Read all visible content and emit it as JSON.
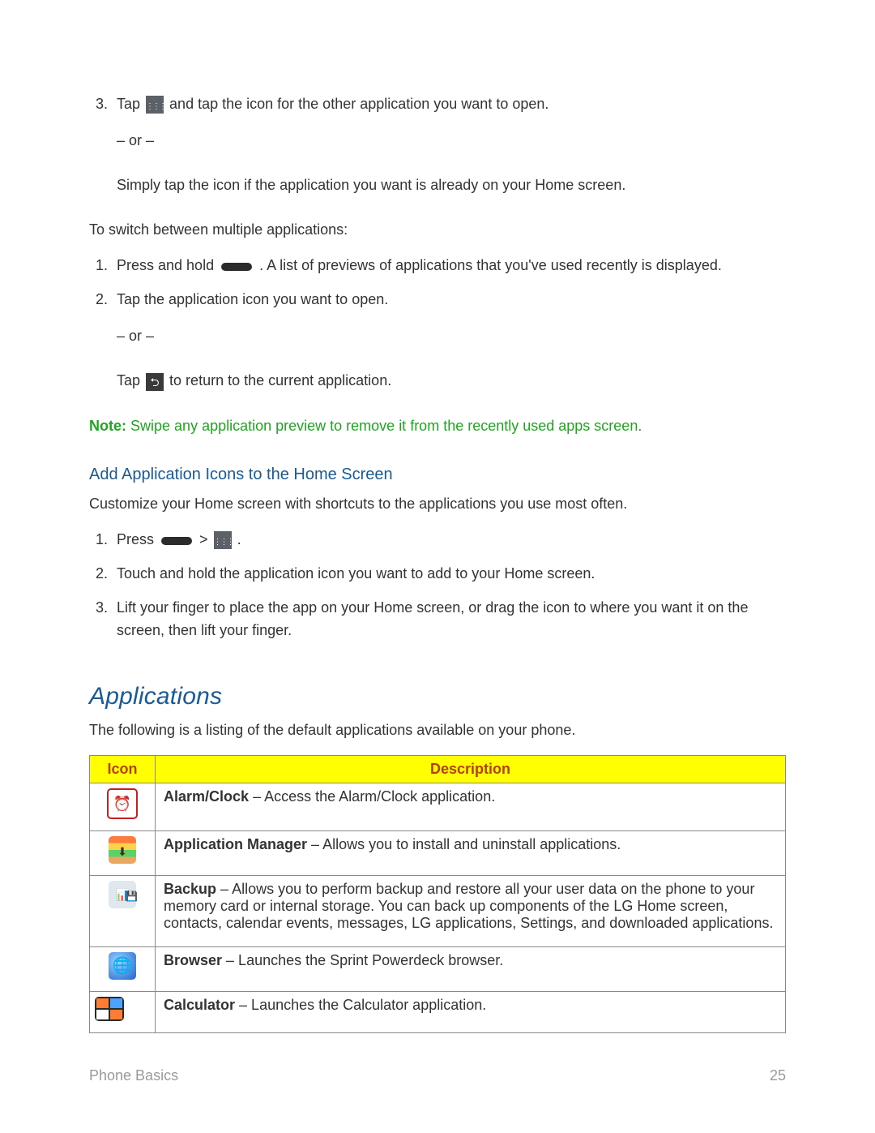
{
  "step3": {
    "before": "Tap ",
    "after": " and tap the icon for the other application you want to open."
  },
  "or_text": "– or –",
  "step3_alt": "Simply tap the icon if the application you want is already on your Home screen.",
  "switch_intro": "To switch between multiple applications:",
  "switch_list": {
    "item1_before": "Press and hold ",
    "item1_after": ". A list of previews of applications that you've used recently is displayed.",
    "item2": "Tap the application icon you want to open."
  },
  "switch_alt_before": "Tap ",
  "switch_alt_after": " to return to the current application.",
  "note": {
    "label": "Note:",
    "text": " Swipe any application preview to remove it from the recently used apps screen."
  },
  "add_icons": {
    "heading": "Add Application Icons to the Home Screen",
    "intro": "Customize your Home screen with shortcuts to the applications you use most often.",
    "steps": {
      "s1_before": "Press ",
      "s1_mid": " > ",
      "s1_after": ".",
      "s2": "Touch and hold the application icon you want to add to your Home screen.",
      "s3": "Lift your finger to place the app on your Home screen, or drag the icon to where you want it on the screen, then lift your finger."
    }
  },
  "applications": {
    "heading": "Applications",
    "intro": "The following is a listing of the default applications available on your phone.",
    "table": {
      "header_icon": "Icon",
      "header_desc": "Description",
      "rows": [
        {
          "name": "Alarm/Clock",
          "desc": " – Access the Alarm/Clock application."
        },
        {
          "name": "Application Manager",
          "desc": " – Allows you to install and uninstall applications."
        },
        {
          "name": "Backup",
          "desc": " – Allows you to perform backup and restore all your user data on the phone to your memory card or internal storage. You can back up components of the LG Home screen, contacts, calendar events, messages, LG applications, Settings, and downloaded applications."
        },
        {
          "name": "Browser",
          "desc": " – Launches the Sprint Powerdeck browser."
        },
        {
          "name": "Calculator",
          "desc": " – Launches the Calculator application."
        }
      ]
    }
  },
  "footer": {
    "section": "Phone Basics",
    "page": "25"
  }
}
